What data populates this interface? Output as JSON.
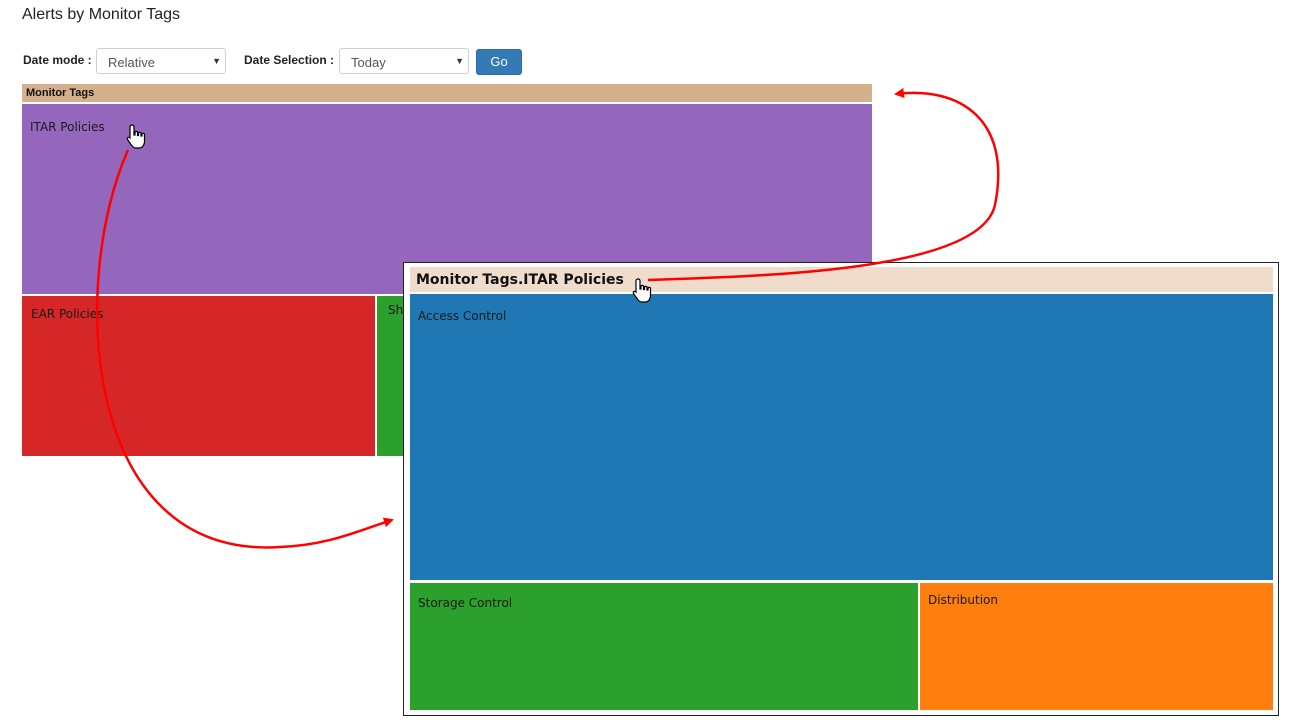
{
  "page": {
    "title": "Alerts by Monitor Tags"
  },
  "filters": {
    "date_mode_label": "Date mode :",
    "date_mode_value": "Relative",
    "date_selection_label": "Date Selection :",
    "date_selection_value": "Today",
    "go_label": "Go"
  },
  "treemap": {
    "header": "Monitor Tags",
    "cells": [
      {
        "label": "ITAR Policies",
        "color": "#9467bd"
      },
      {
        "label": "EAR Policies",
        "color": "#d62728"
      },
      {
        "label": "Sh",
        "color": "#2ca02c"
      }
    ]
  },
  "detail": {
    "header": "Monitor Tags.ITAR Policies",
    "cells": [
      {
        "label": "Access Control",
        "color": "#1f77b4"
      },
      {
        "label": "Storage Control",
        "color": "#2ca02c"
      },
      {
        "label": "Distribution",
        "color": "#ff7f0e"
      }
    ]
  },
  "annotation_color": "#ff0000",
  "icons": [
    "hand-pointer-icon",
    "arrow-icon",
    "chevron-down-icon"
  ]
}
